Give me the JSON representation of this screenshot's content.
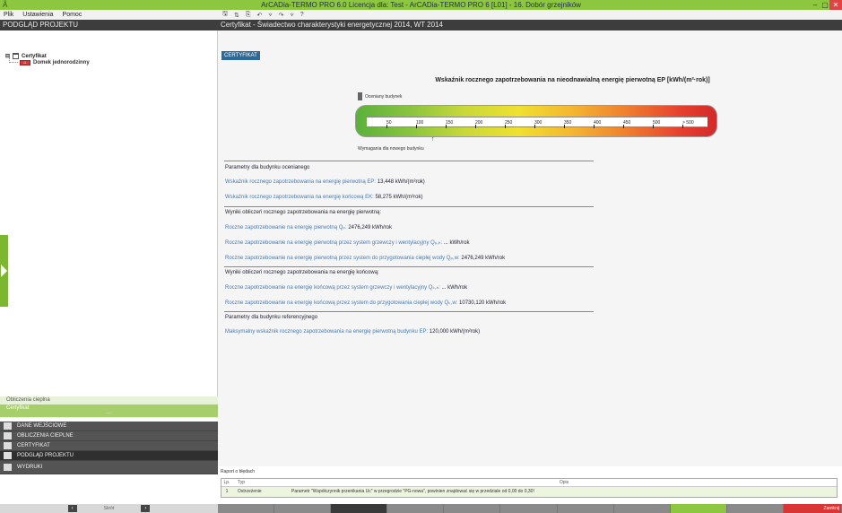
{
  "window": {
    "title": "ArCADia-TERMO PRO 6.0 Licencja dla: Test - ArCADia-TERMO PRO 6 [L01] - 16. Dobór grzejników",
    "min": "–",
    "max": "▢",
    "close": "✕",
    "app_icon": "Ã"
  },
  "menu": {
    "items": [
      "Plik",
      "Ustawienia",
      "Pomoc"
    ]
  },
  "toolbar": {
    "icons": [
      "save-icon",
      "settings-icon",
      "copy-icon",
      "undo-icon",
      "filter-icon",
      "redo-icon",
      "funnel-icon",
      "help-icon"
    ],
    "glyphs": [
      "🖫",
      "⇅",
      "⎘",
      "↶",
      "⩒",
      "↷",
      "⩒",
      "?"
    ]
  },
  "left_panel": {
    "header": "PODGLĄD PROJEKTU",
    "tree": {
      "root": "Certyfikat",
      "child": "Domek jednorodzinny"
    },
    "subnav": [
      "Obliczenia cieplna",
      "Certyfikat"
    ],
    "nav": [
      "DANE WEJŚCIOWE",
      "OBLICZENIA CIEPLNE",
      "CERTYFIKAT",
      "PODGLĄD PROJEKTU",
      "WYDRUKI"
    ],
    "bottom": {
      "prev": "‹",
      "label": "Skrót",
      "next": "›"
    }
  },
  "main": {
    "header": "Certyfikat - Świadectwo charakterystyki energetycznej 2014, WT 2014",
    "tab": "CERTYFIKAT",
    "scale": {
      "title": "Wskaźnik rocznego zapotrzebowania na nieodnawialną energię pierwotną EP [kWh/(m²·rok)]",
      "top_marker": "Oceniany budynek",
      "bottom_marker": "Wymagania dla nowego budynku",
      "bottom_arrow": "↑",
      "ticks": [
        "50",
        "100",
        "150",
        "200",
        "250",
        "300",
        "350",
        "400",
        "450",
        "500",
        "> 500"
      ]
    },
    "sections": [
      {
        "type": "section",
        "text": "Parametry dla budynku ocenianego"
      },
      {
        "type": "line",
        "label": "Wskaźnik rocznego zapotrzebowania na energię pierwotną EP:",
        "value": "13,448 kWh/(m²rok)"
      },
      {
        "type": "line",
        "label": "Wskaźnik rocznego zapotrzebowania na energię końcową EK:",
        "value": "58,275 kWh/(m²rok)"
      },
      {
        "type": "section",
        "text": "Wyniki obliczeń rocznego zapotrzebowania na energię pierwotną:"
      },
      {
        "type": "line",
        "label": "Roczne zapotrzebowanie na energię pierwotną Qₚ:",
        "value": "2476,249 kWh/rok"
      },
      {
        "type": "line",
        "label": "Roczne zapotrzebowanie na energię pierwotną przez system grzewczy i wentylacyjny Qₚ,ₕ:",
        "value": "... kWh/rok"
      },
      {
        "type": "line",
        "label": "Roczne zapotrzebowanie na energię pierwotną przez system do przygotowania ciepłej wody Qₚ,w:",
        "value": "2476,249 kWh/rok"
      },
      {
        "type": "section",
        "text": "Wyniki obliczeń rocznego zapotrzebowania na energię końcową:"
      },
      {
        "type": "line",
        "label": "Roczne zapotrzebowanie na energię końcową przez system grzewczy i wentylacyjny Qₖ,ₕ:",
        "value": "... kWh/rok"
      },
      {
        "type": "line",
        "label": "Roczne zapotrzebowanie na energię końcową przez system do przygotowania ciepłej wody Qₖ,w:",
        "value": "10730,120 kWh/rok"
      },
      {
        "type": "section",
        "text": "Parametry dla budynku referencyjnego"
      },
      {
        "type": "line",
        "label": "Maksymalny wskaźnik rocznego zapotrzebowania na energię pierwotną budynku EP:",
        "value": "120,000 kWh/(m²rok)"
      }
    ]
  },
  "report": {
    "label": "Raport o błędach",
    "headers": [
      "Lp.",
      "Typ",
      "Opis"
    ],
    "rows": [
      {
        "lp": "1",
        "typ": "Ostrzeżenie",
        "opis": "Parametr \"Współczynnik przenikania Uc\" w przegrodzie \"PG-nowa\", powinien znajdować się w przedziale od 0,00 do 0,30!"
      }
    ]
  },
  "bottom_bar": {
    "close_label": "Zamknij"
  }
}
